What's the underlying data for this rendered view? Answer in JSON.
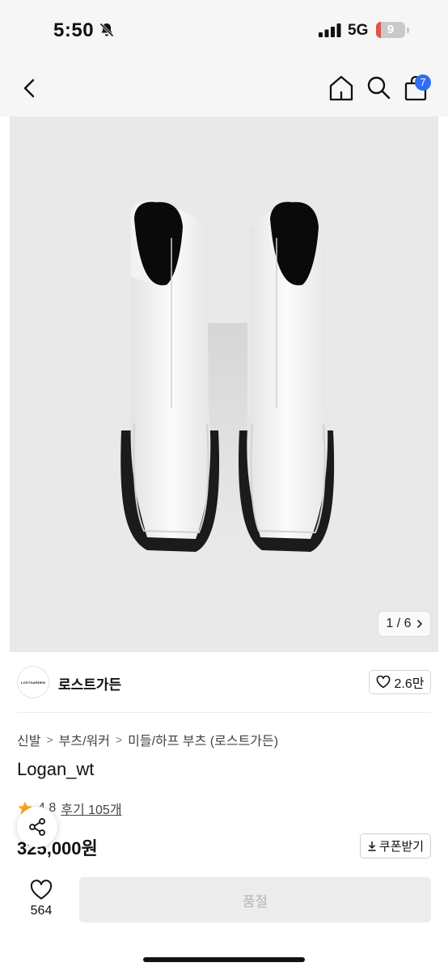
{
  "status": {
    "time": "5:50",
    "network": "5G",
    "battery": "9",
    "battery_level": 0.09
  },
  "header": {
    "cart_count": "7"
  },
  "gallery": {
    "counter": "1 / 6"
  },
  "brand": {
    "logo_text": "LOSTGARDEN",
    "name": "로스트가든",
    "likes": "2.6만"
  },
  "product": {
    "breadcrumb": [
      "신발",
      "부츠/워커",
      "미들/하프 부츠 (로스트가든)"
    ],
    "name": "Logan_wt",
    "rating": "4.8",
    "reviews": "후기 105개",
    "price": "325,000원",
    "coupon_label": "쿠폰받기"
  },
  "bottom": {
    "wish_count": "564",
    "action_label": "품절"
  },
  "colors": {
    "accent": "#2f6df5",
    "star": "#f5a623",
    "battery_low": "#e05548"
  }
}
